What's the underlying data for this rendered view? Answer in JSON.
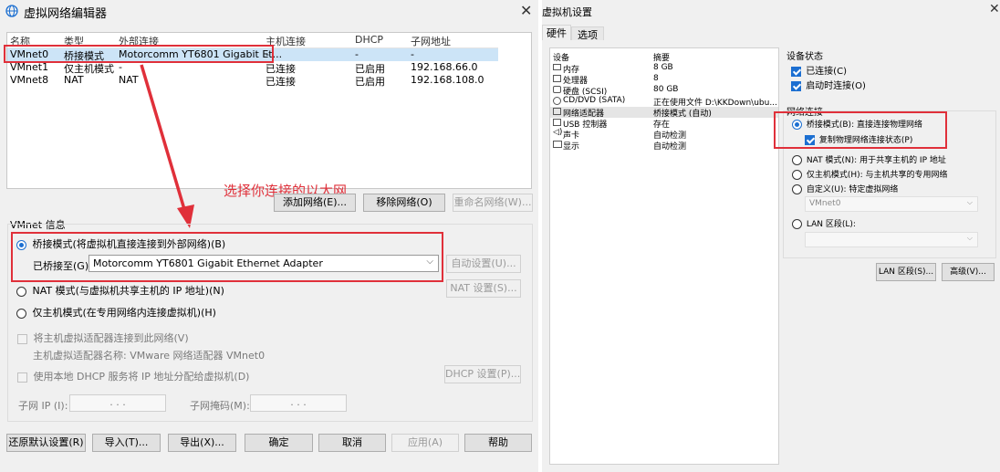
{
  "left_window": {
    "title": "虚拟网络编辑器",
    "table": {
      "headers": [
        "名称",
        "类型",
        "外部连接",
        "主机连接",
        "DHCP",
        "子网地址"
      ],
      "rows": [
        [
          "VMnet0",
          "桥接模式",
          "Motorcomm YT6801 Gigabit Et...",
          "-",
          "-",
          "-"
        ],
        [
          "VMnet1",
          "仅主机模式",
          "-",
          "已连接",
          "已启用",
          "192.168.66.0"
        ],
        [
          "VMnet8",
          "NAT",
          "NAT",
          "已连接",
          "已启用",
          "192.168.108.0"
        ]
      ]
    },
    "annotation_text": "选择你连接的以太网",
    "buttons": {
      "add_network": "添加网络(E)...",
      "remove_network": "移除网络(O)",
      "rename_network": "重命名网络(W)..."
    },
    "vmnet_info": {
      "label": "VMnet 信息",
      "bridged_mode": "桥接模式(将虚拟机直接连接到外部网络)(B)",
      "bridged_to_label": "已桥接至(G):",
      "bridged_to_value": "Motorcomm YT6801 Gigabit Ethernet Adapter",
      "auto_settings": "自动设置(U)...",
      "nat_mode": "NAT 模式(与虚拟机共享主机的 IP 地址)(N)",
      "nat_settings": "NAT 设置(S)...",
      "host_only_mode": "仅主机模式(在专用网络内连接虚拟机)(H)",
      "connect_host_adapter": "将主机虚拟适配器连接到此网络(V)",
      "host_adapter_name": "主机虚拟适配器名称: VMware 网络适配器 VMnet0",
      "use_dhcp": "使用本地 DHCP 服务将 IP 地址分配给虚拟机(D)",
      "dhcp_settings": "DHCP 设置(P)...",
      "subnet_ip_label": "子网 IP (I):",
      "subnet_mask_label": "子网掩码(M):",
      "ip_dots": ".      .      ."
    },
    "bottom_buttons": {
      "restore": "还原默认设置(R)",
      "import": "导入(T)...",
      "export": "导出(X)...",
      "ok": "确定",
      "cancel": "取消",
      "apply": "应用(A)",
      "help": "帮助"
    }
  },
  "right_window": {
    "title": "虚拟机设置",
    "tabs": [
      "硬件",
      "选项"
    ],
    "device_table": {
      "headers": [
        "设备",
        "摘要"
      ],
      "rows": [
        {
          "icon": "memory-icon",
          "device": "内存",
          "summary": "8 GB"
        },
        {
          "icon": "cpu-icon",
          "device": "处理器",
          "summary": "8"
        },
        {
          "icon": "disk-icon",
          "device": "硬盘 (SCSI)",
          "summary": "80 GB"
        },
        {
          "icon": "cd-icon",
          "device": "CD/DVD (SATA)",
          "summary": "正在使用文件 D:\\KKDown\\ubu..."
        },
        {
          "icon": "network-icon",
          "device": "网络适配器",
          "summary": "桥接模式 (自动)"
        },
        {
          "icon": "usb-icon",
          "device": "USB 控制器",
          "summary": "存在"
        },
        {
          "icon": "sound-icon",
          "device": "声卡",
          "summary": "自动检测"
        },
        {
          "icon": "display-icon",
          "device": "显示",
          "summary": "自动检测"
        }
      ]
    },
    "device_status": {
      "label": "设备状态",
      "connected": "已连接(C)",
      "connect_on_power": "启动时连接(O)"
    },
    "network_connection": {
      "label": "网络连接",
      "bridged": "桥接模式(B): 直接连接物理网络",
      "replicate": "复制物理网络连接状态(P)",
      "nat": "NAT 模式(N): 用于共享主机的 IP 地址",
      "host_only": "仅主机模式(H): 与主机共享的专用网络",
      "custom": "自定义(U): 特定虚拟网络",
      "custom_value": "VMnet0",
      "lan": "LAN 区段(L):"
    },
    "buttons": {
      "lan_segments": "LAN 区段(S)...",
      "advanced": "高级(V)..."
    }
  },
  "colors": {
    "accent": "#1c6fd1",
    "annotation_red": "#e0303a",
    "selection": "#cce4f7"
  }
}
